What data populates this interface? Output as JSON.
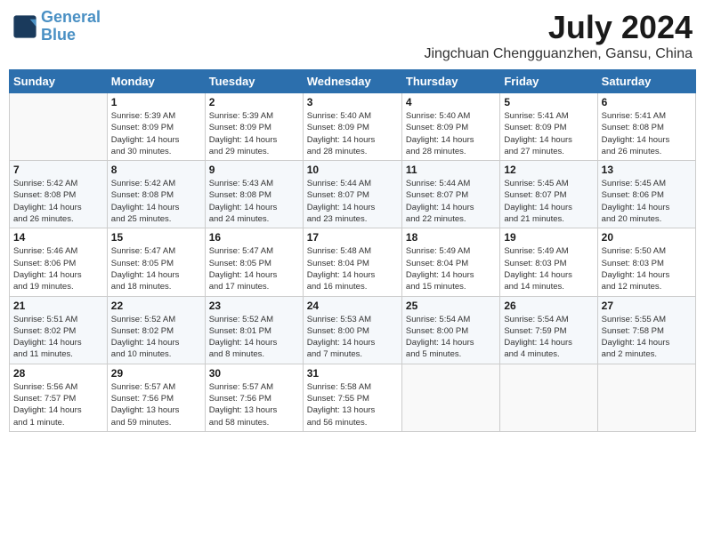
{
  "header": {
    "logo_line1": "General",
    "logo_line2": "Blue",
    "month_year": "July 2024",
    "location": "Jingchuan Chengguanzhen, Gansu, China"
  },
  "weekdays": [
    "Sunday",
    "Monday",
    "Tuesday",
    "Wednesday",
    "Thursday",
    "Friday",
    "Saturday"
  ],
  "weeks": [
    [
      {
        "day": "",
        "info": ""
      },
      {
        "day": "1",
        "info": "Sunrise: 5:39 AM\nSunset: 8:09 PM\nDaylight: 14 hours\nand 30 minutes."
      },
      {
        "day": "2",
        "info": "Sunrise: 5:39 AM\nSunset: 8:09 PM\nDaylight: 14 hours\nand 29 minutes."
      },
      {
        "day": "3",
        "info": "Sunrise: 5:40 AM\nSunset: 8:09 PM\nDaylight: 14 hours\nand 28 minutes."
      },
      {
        "day": "4",
        "info": "Sunrise: 5:40 AM\nSunset: 8:09 PM\nDaylight: 14 hours\nand 28 minutes."
      },
      {
        "day": "5",
        "info": "Sunrise: 5:41 AM\nSunset: 8:09 PM\nDaylight: 14 hours\nand 27 minutes."
      },
      {
        "day": "6",
        "info": "Sunrise: 5:41 AM\nSunset: 8:08 PM\nDaylight: 14 hours\nand 26 minutes."
      }
    ],
    [
      {
        "day": "7",
        "info": "Sunrise: 5:42 AM\nSunset: 8:08 PM\nDaylight: 14 hours\nand 26 minutes."
      },
      {
        "day": "8",
        "info": "Sunrise: 5:42 AM\nSunset: 8:08 PM\nDaylight: 14 hours\nand 25 minutes."
      },
      {
        "day": "9",
        "info": "Sunrise: 5:43 AM\nSunset: 8:08 PM\nDaylight: 14 hours\nand 24 minutes."
      },
      {
        "day": "10",
        "info": "Sunrise: 5:44 AM\nSunset: 8:07 PM\nDaylight: 14 hours\nand 23 minutes."
      },
      {
        "day": "11",
        "info": "Sunrise: 5:44 AM\nSunset: 8:07 PM\nDaylight: 14 hours\nand 22 minutes."
      },
      {
        "day": "12",
        "info": "Sunrise: 5:45 AM\nSunset: 8:07 PM\nDaylight: 14 hours\nand 21 minutes."
      },
      {
        "day": "13",
        "info": "Sunrise: 5:45 AM\nSunset: 8:06 PM\nDaylight: 14 hours\nand 20 minutes."
      }
    ],
    [
      {
        "day": "14",
        "info": "Sunrise: 5:46 AM\nSunset: 8:06 PM\nDaylight: 14 hours\nand 19 minutes."
      },
      {
        "day": "15",
        "info": "Sunrise: 5:47 AM\nSunset: 8:05 PM\nDaylight: 14 hours\nand 18 minutes."
      },
      {
        "day": "16",
        "info": "Sunrise: 5:47 AM\nSunset: 8:05 PM\nDaylight: 14 hours\nand 17 minutes."
      },
      {
        "day": "17",
        "info": "Sunrise: 5:48 AM\nSunset: 8:04 PM\nDaylight: 14 hours\nand 16 minutes."
      },
      {
        "day": "18",
        "info": "Sunrise: 5:49 AM\nSunset: 8:04 PM\nDaylight: 14 hours\nand 15 minutes."
      },
      {
        "day": "19",
        "info": "Sunrise: 5:49 AM\nSunset: 8:03 PM\nDaylight: 14 hours\nand 14 minutes."
      },
      {
        "day": "20",
        "info": "Sunrise: 5:50 AM\nSunset: 8:03 PM\nDaylight: 14 hours\nand 12 minutes."
      }
    ],
    [
      {
        "day": "21",
        "info": "Sunrise: 5:51 AM\nSunset: 8:02 PM\nDaylight: 14 hours\nand 11 minutes."
      },
      {
        "day": "22",
        "info": "Sunrise: 5:52 AM\nSunset: 8:02 PM\nDaylight: 14 hours\nand 10 minutes."
      },
      {
        "day": "23",
        "info": "Sunrise: 5:52 AM\nSunset: 8:01 PM\nDaylight: 14 hours\nand 8 minutes."
      },
      {
        "day": "24",
        "info": "Sunrise: 5:53 AM\nSunset: 8:00 PM\nDaylight: 14 hours\nand 7 minutes."
      },
      {
        "day": "25",
        "info": "Sunrise: 5:54 AM\nSunset: 8:00 PM\nDaylight: 14 hours\nand 5 minutes."
      },
      {
        "day": "26",
        "info": "Sunrise: 5:54 AM\nSunset: 7:59 PM\nDaylight: 14 hours\nand 4 minutes."
      },
      {
        "day": "27",
        "info": "Sunrise: 5:55 AM\nSunset: 7:58 PM\nDaylight: 14 hours\nand 2 minutes."
      }
    ],
    [
      {
        "day": "28",
        "info": "Sunrise: 5:56 AM\nSunset: 7:57 PM\nDaylight: 14 hours\nand 1 minute."
      },
      {
        "day": "29",
        "info": "Sunrise: 5:57 AM\nSunset: 7:56 PM\nDaylight: 13 hours\nand 59 minutes."
      },
      {
        "day": "30",
        "info": "Sunrise: 5:57 AM\nSunset: 7:56 PM\nDaylight: 13 hours\nand 58 minutes."
      },
      {
        "day": "31",
        "info": "Sunrise: 5:58 AM\nSunset: 7:55 PM\nDaylight: 13 hours\nand 56 minutes."
      },
      {
        "day": "",
        "info": ""
      },
      {
        "day": "",
        "info": ""
      },
      {
        "day": "",
        "info": ""
      }
    ]
  ]
}
